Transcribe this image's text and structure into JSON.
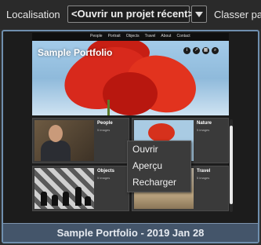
{
  "toolbar": {
    "location_label": "Localisation",
    "project_select_value": "<Ouvrir un projet récent>",
    "sort_label": "Classer pa"
  },
  "preview": {
    "nav_items": [
      "People",
      "Portrait",
      "Objects",
      "Travel",
      "About",
      "Contact"
    ],
    "site_title": "Sample Portfolio",
    "hero_icons": [
      "info-icon",
      "share-icon",
      "grid-icon",
      "search-icon"
    ]
  },
  "albums": [
    {
      "name": "People",
      "count": "5 images"
    },
    {
      "name": "Nature",
      "count": "5 images"
    },
    {
      "name": "Objects",
      "count": "5 images"
    },
    {
      "name": "Travel",
      "count": "5 images"
    }
  ],
  "context_menu": {
    "items": [
      "Ouvrir",
      "Aperçu",
      "Recharger"
    ]
  },
  "footer": {
    "caption": "Sample Portfolio - 2019 Jan 28"
  },
  "colors": {
    "frame_border": "#6f8fae",
    "footer_bg": "#44556a",
    "accent_red": "#d8291c"
  }
}
